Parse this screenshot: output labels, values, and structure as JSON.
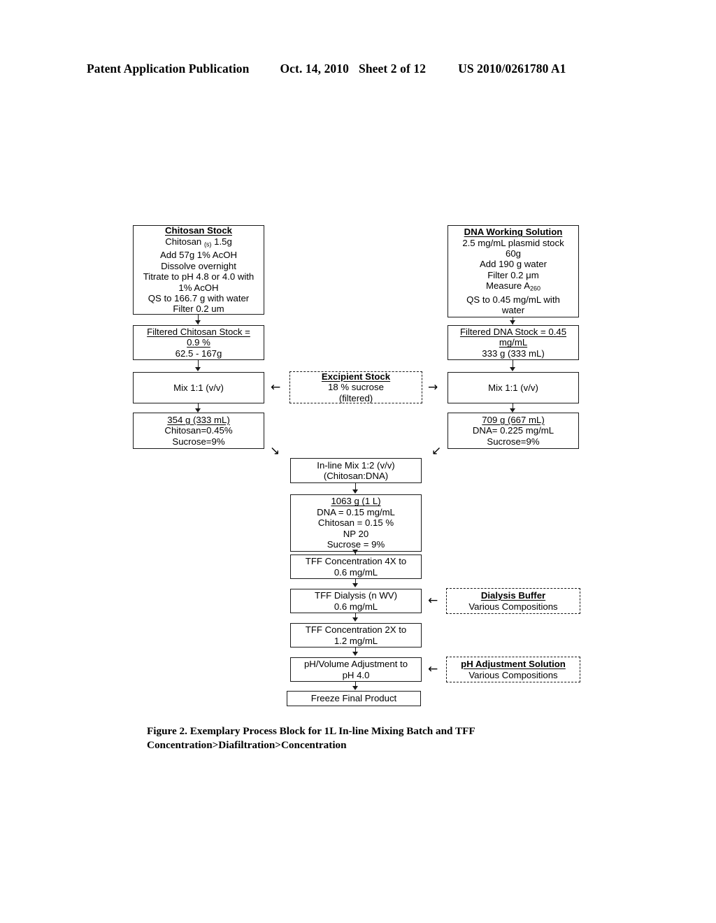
{
  "header": {
    "title": "Patent Application Publication",
    "date": "Oct. 14, 2010",
    "sheet": "Sheet 2 of 12",
    "patent_number": "US 2010/0261780 A1"
  },
  "caption": {
    "line1": "Figure 2.  Exemplary Process Block for 1L In-line Mixing Batch and TFF",
    "line2": "Concentration>Diafiltration>Concentration"
  },
  "nodes": {
    "chitosan_stock": {
      "title": "Chitosan Stock",
      "l1_a": "Chitosan",
      "l1_sub": "(s)",
      "l1_b": "1.5g",
      "l2": "Add 57g 1% AcOH",
      "l3": "Dissolve overnight",
      "l4": "Titrate to pH 4.8 or 4.0 with",
      "l5": "1% AcOH",
      "l6": "QS to 166.7 g with water",
      "l7": "Filter 0.2 um"
    },
    "dna_working_solution": {
      "title": "DNA Working Solution",
      "l1": "2.5 mg/mL plasmid stock",
      "l2": "60g",
      "l3": "Add 190 g water",
      "l4": "Filter 0.2 μm",
      "l5_a": "Measure A",
      "l5_sub": "260",
      "l6": "QS to 0.45 mg/mL with",
      "l7": "water"
    },
    "filtered_chitosan_stock": {
      "l1": "Filtered Chitosan Stock =",
      "l2": "0.9 %",
      "l3": "62.5 - 167g"
    },
    "filtered_dna_stock": {
      "l1": "Filtered DNA Stock = 0.45",
      "l2": "mg/mL",
      "l3": "333 g (333 mL)"
    },
    "mix_left": {
      "l1": "Mix 1:1 (v/v)"
    },
    "mix_right": {
      "l1": "Mix 1:1 (v/v)"
    },
    "excipient_stock": {
      "title": "Excipient Stock",
      "l1": "18 % sucrose",
      "l2": "(filtered)"
    },
    "chitosan_result": {
      "l1": "354 g (333 mL)",
      "l2": "Chitosan=0.45%",
      "l3": "Sucrose=9%"
    },
    "dna_result": {
      "l1": "709 g (667 mL)",
      "l2": "DNA= 0.225 mg/mL",
      "l3": "Sucrose=9%"
    },
    "inline_mix": {
      "l1": "In-line Mix 1:2 (v/v)",
      "l2": "(Chitosan:DNA)"
    },
    "combined_result": {
      "l1": "1063 g (1 L)",
      "l2": "DNA = 0.15 mg/mL",
      "l3": "Chitosan = 0.15 %",
      "l4": "NP 20",
      "l5": "Sucrose = 9%"
    },
    "tff_conc_4x": {
      "l1": "TFF Concentration 4X to",
      "l2": "0.6 mg/mL"
    },
    "tff_dialysis": {
      "l1": "TFF Dialysis (n WV)",
      "l2": "0.6 mg/mL"
    },
    "tff_conc_2x": {
      "l1": "TFF Concentration 2X to",
      "l2": "1.2 mg/mL"
    },
    "ph_adjustment": {
      "l1": "pH/Volume Adjustment to",
      "l2": "pH 4.0"
    },
    "freeze_final": {
      "l1": "Freeze Final Product"
    },
    "dialysis_buffer": {
      "title": "Dialysis Buffer",
      "l1": "Various Compositions"
    },
    "ph_adjustment_solution": {
      "title": "pH Adjustment Solution",
      "l1": "Various Compositions"
    }
  },
  "arrows": {
    "left_arrow_glyph": "←",
    "right_arrow_glyph": "→",
    "down_right_glyph": "↘",
    "down_left_glyph": "↙"
  },
  "colors": {
    "ink": "#1a1a1a",
    "paper": "#ffffff"
  }
}
